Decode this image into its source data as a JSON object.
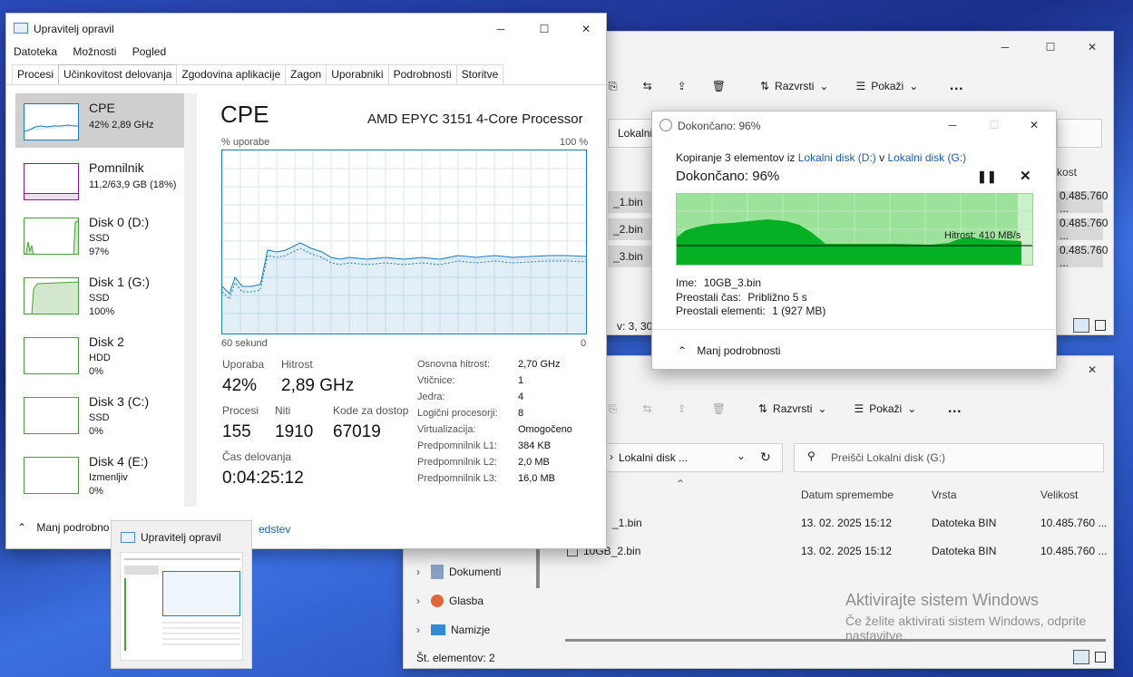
{
  "explorer_top": {
    "toolbar": {
      "sort": "Razvrsti",
      "view": "Pokaži",
      "more": "…"
    },
    "address": "Lokalni",
    "column_size": "kost",
    "rows": [
      {
        "name": "_1.bin",
        "size": "0.485.760 ..."
      },
      {
        "name": "_2.bin",
        "size": "0.485.760 ..."
      },
      {
        "name": "_3.bin",
        "size": "0.485.760 ..."
      }
    ],
    "status": "v: 3, 30,0"
  },
  "explorer_bottom": {
    "toolbar": {
      "sort": "Razvrsti",
      "view": "Pokaži",
      "more": "…"
    },
    "address": "Lokalni disk ...",
    "search_placeholder": "Preišči Lokalni disk (G:)",
    "columns": {
      "date": "Datum spremembe",
      "type": "Vrsta",
      "size": "Velikost"
    },
    "rows": [
      {
        "name": "_1.bin",
        "date": "13. 02. 2025 15:12",
        "type": "Datoteka BIN",
        "size": "10.485.760 ..."
      },
      {
        "name": "10GB_2.bin",
        "date": "13. 02. 2025 15:12",
        "type": "Datoteka BIN",
        "size": "10.485.760 ..."
      }
    ],
    "nav": [
      "Dokumenti",
      "Glasba",
      "Namizje"
    ],
    "status": "Št. elementov: 2"
  },
  "watermark": {
    "title": "Aktivirajte sistem Windows",
    "line1": "Če želite aktivirati sistem Windows, odprite",
    "line2": "nastavitve."
  },
  "task_manager": {
    "title": "Upravitelj opravil",
    "menu": [
      "Datoteka",
      "Možnosti",
      "Pogled"
    ],
    "tabs": [
      "Procesi",
      "Učinkovitost delovanja",
      "Zgodovina aplikacije",
      "Zagon",
      "Uporabniki",
      "Podrobnosti",
      "Storitve"
    ],
    "sidebar": [
      {
        "title": "CPE",
        "sub1": "42% 2,89 GHz",
        "sub2": "",
        "sub3": "",
        "color": "#1a7bbf"
      },
      {
        "title": "Pomnilnik",
        "sub1": "11,2/63,9 GB (18%)",
        "sub2": "",
        "sub3": "",
        "color": "#8a1a9b"
      },
      {
        "title": "Disk 0 (D:)",
        "sub1": "SSD",
        "sub2": "97%",
        "sub3": "",
        "color": "#4aa03a"
      },
      {
        "title": "Disk 1 (G:)",
        "sub1": "SSD",
        "sub2": "100%",
        "sub3": "",
        "color": "#4aa03a"
      },
      {
        "title": "Disk 2",
        "sub1": "HDD",
        "sub2": "0%",
        "sub3": "",
        "color": "#4aa03a"
      },
      {
        "title": "Disk 3 (C:)",
        "sub1": "SSD",
        "sub2": "0%",
        "sub3": "",
        "color": "#4aa03a"
      },
      {
        "title": "Disk 4 (E:)",
        "sub1": "Izmenljiv",
        "sub2": "0%",
        "sub3": "",
        "color": "#4aa03a"
      }
    ],
    "main": {
      "heading": "CPE",
      "processor": "AMD EPYC 3151 4-Core Processor",
      "usage_label": "% uporabe",
      "usage_max": "100 %",
      "time_label": "60 sekund",
      "time_zero": "0",
      "stats": {
        "usage_label": "Uporaba",
        "usage": "42%",
        "speed_label": "Hitrost",
        "speed": "2,89 GHz",
        "processes_label": "Procesi",
        "processes": "155",
        "threads_label": "Niti",
        "threads": "1910",
        "handles_label": "Kode za dostop",
        "handles": "67019",
        "uptime_label": "Čas delovanja",
        "uptime": "0:04:25:12"
      },
      "details": [
        {
          "k": "Osnovna hitrost:",
          "v": "2,70 GHz"
        },
        {
          "k": "Vtičnice:",
          "v": "1"
        },
        {
          "k": "Jedra:",
          "v": "4"
        },
        {
          "k": "Logični procesorji:",
          "v": "8"
        },
        {
          "k": "Virtualizacija:",
          "v": "Omogočeno"
        },
        {
          "k": "Predpomnilnik L1:",
          "v": "384 KB"
        },
        {
          "k": "Predpomnilnik L2:",
          "v": "2,0 MB"
        },
        {
          "k": "Predpomnilnik L3:",
          "v": "16,0 MB"
        }
      ]
    },
    "footer_less": "Manj podrobno",
    "footer_link": "edstev"
  },
  "taskbar_preview": {
    "title": "Upravitelj opravil"
  },
  "copy_dialog": {
    "title": "Dokončano: 96%",
    "line_prefix": "Kopiranje 3 elementov iz",
    "source": "Lokalni disk (D:)",
    "line_mid": "v",
    "dest": "Lokalni disk (G:)",
    "heading": "Dokončano: 96%",
    "progress_percent": 96,
    "speed": "Hitrost: 410 MB/s",
    "name_label": "Ime:",
    "name": "10GB_3.bin",
    "remaining_time_label": "Preostali čas:",
    "remaining_time": "Približno 5 s",
    "remaining_items_label": "Preostali elementi:",
    "remaining_items": "1 (927 MB)",
    "less": "Manj podrobnosti"
  },
  "colors": {
    "cpu": "#1a7bbf",
    "disk": "#4aa03a",
    "memory": "#8a1a9b",
    "progress": "#06b025"
  }
}
